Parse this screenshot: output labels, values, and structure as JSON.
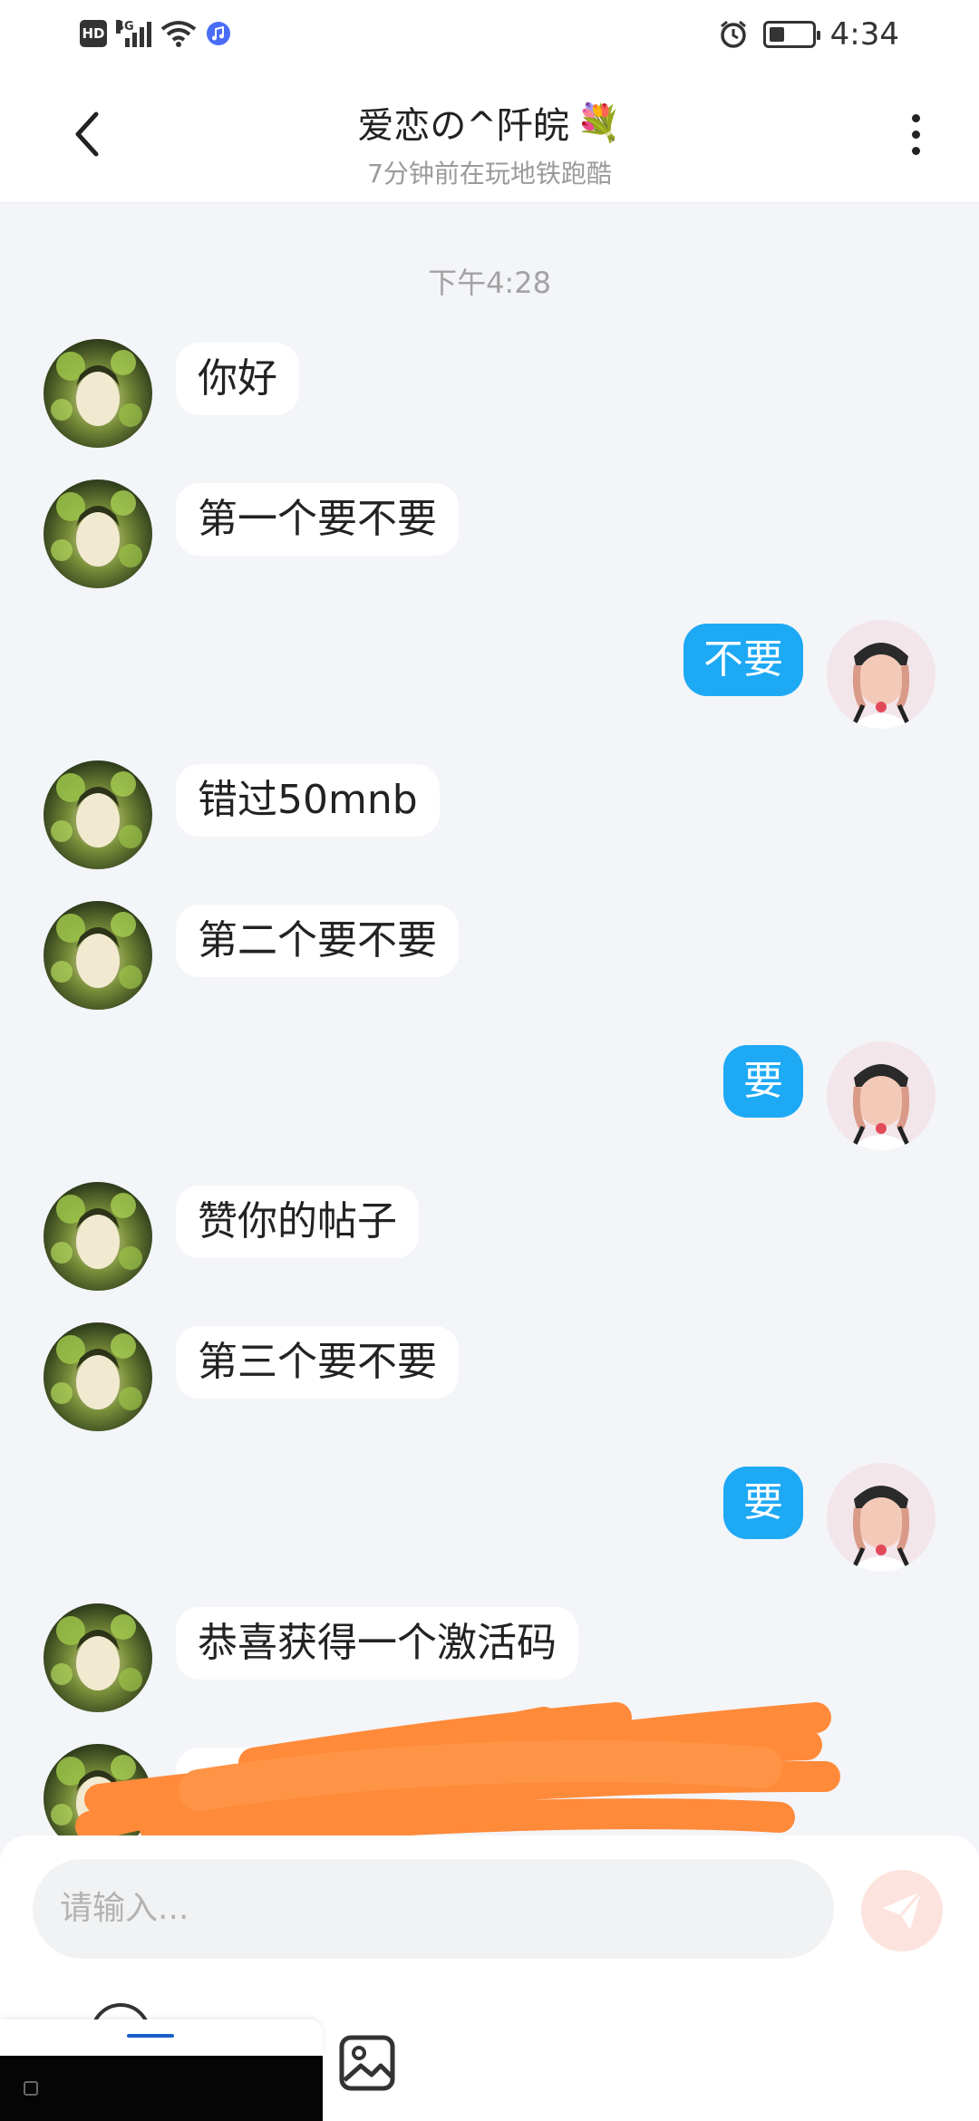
{
  "status_bar": {
    "hd_label": "HD",
    "network_label": "4G",
    "time": "4:34"
  },
  "header": {
    "title": "爱恋の^阡皖",
    "title_emoji": "💐",
    "subtitle": "7分钟前在玩地铁跑酷"
  },
  "chat": {
    "timestamp": "下午4:28",
    "messages": [
      {
        "side": "in",
        "text": "你好"
      },
      {
        "side": "in",
        "text": "第一个要不要"
      },
      {
        "side": "out",
        "text": "不要"
      },
      {
        "side": "in",
        "text": "错过50mnb"
      },
      {
        "side": "in",
        "text": "第二个要不要"
      },
      {
        "side": "out",
        "text": "要"
      },
      {
        "side": "in",
        "text": "赞你的帖子"
      },
      {
        "side": "in",
        "text": "第三个要不要"
      },
      {
        "side": "out",
        "text": "要"
      },
      {
        "side": "in",
        "text": "恭喜获得一个激活码"
      },
      {
        "side": "in",
        "text": ""
      }
    ]
  },
  "input": {
    "placeholder": "请输入..."
  },
  "colors": {
    "outgoing_bubble": "#1ea9f5",
    "redaction": "#ff8a3a",
    "send_button": "#fde3de"
  },
  "icons": [
    "back-icon",
    "more-icon",
    "send-icon",
    "emoji-icon",
    "image-icon"
  ]
}
